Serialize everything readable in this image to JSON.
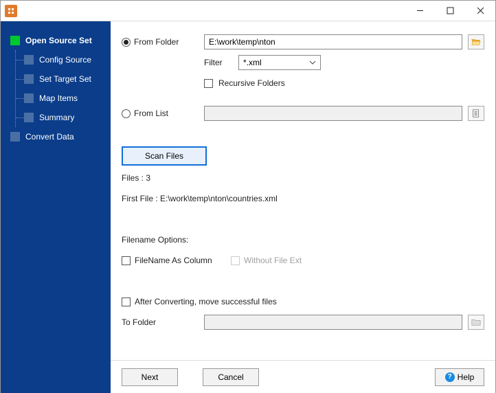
{
  "sidebar": {
    "items": [
      {
        "label": "Open Source Set",
        "active": true
      },
      {
        "label": "Config Source"
      },
      {
        "label": "Set Target Set"
      },
      {
        "label": "Map Items"
      },
      {
        "label": "Summary"
      }
    ],
    "last": {
      "label": "Convert Data"
    }
  },
  "source": {
    "from_folder_label": "From Folder",
    "folder_value": "E:\\work\\temp\\nton",
    "filter_label": "Filter",
    "filter_value": "*.xml",
    "recursive_label": "Recursive Folders",
    "from_list_label": "From List"
  },
  "scan": {
    "button_label": "Scan Files",
    "files_label": "Files : 3",
    "first_file_label": "First File : E:\\work\\temp\\nton\\countries.xml"
  },
  "filename_options": {
    "heading": "Filename Options:",
    "as_column": "FileName As Column",
    "without_ext": "Without File Ext"
  },
  "after": {
    "move_label": "After Converting, move successful files",
    "to_folder_label": "To Folder"
  },
  "buttons": {
    "next": "Next",
    "cancel": "Cancel",
    "help": "Help"
  }
}
